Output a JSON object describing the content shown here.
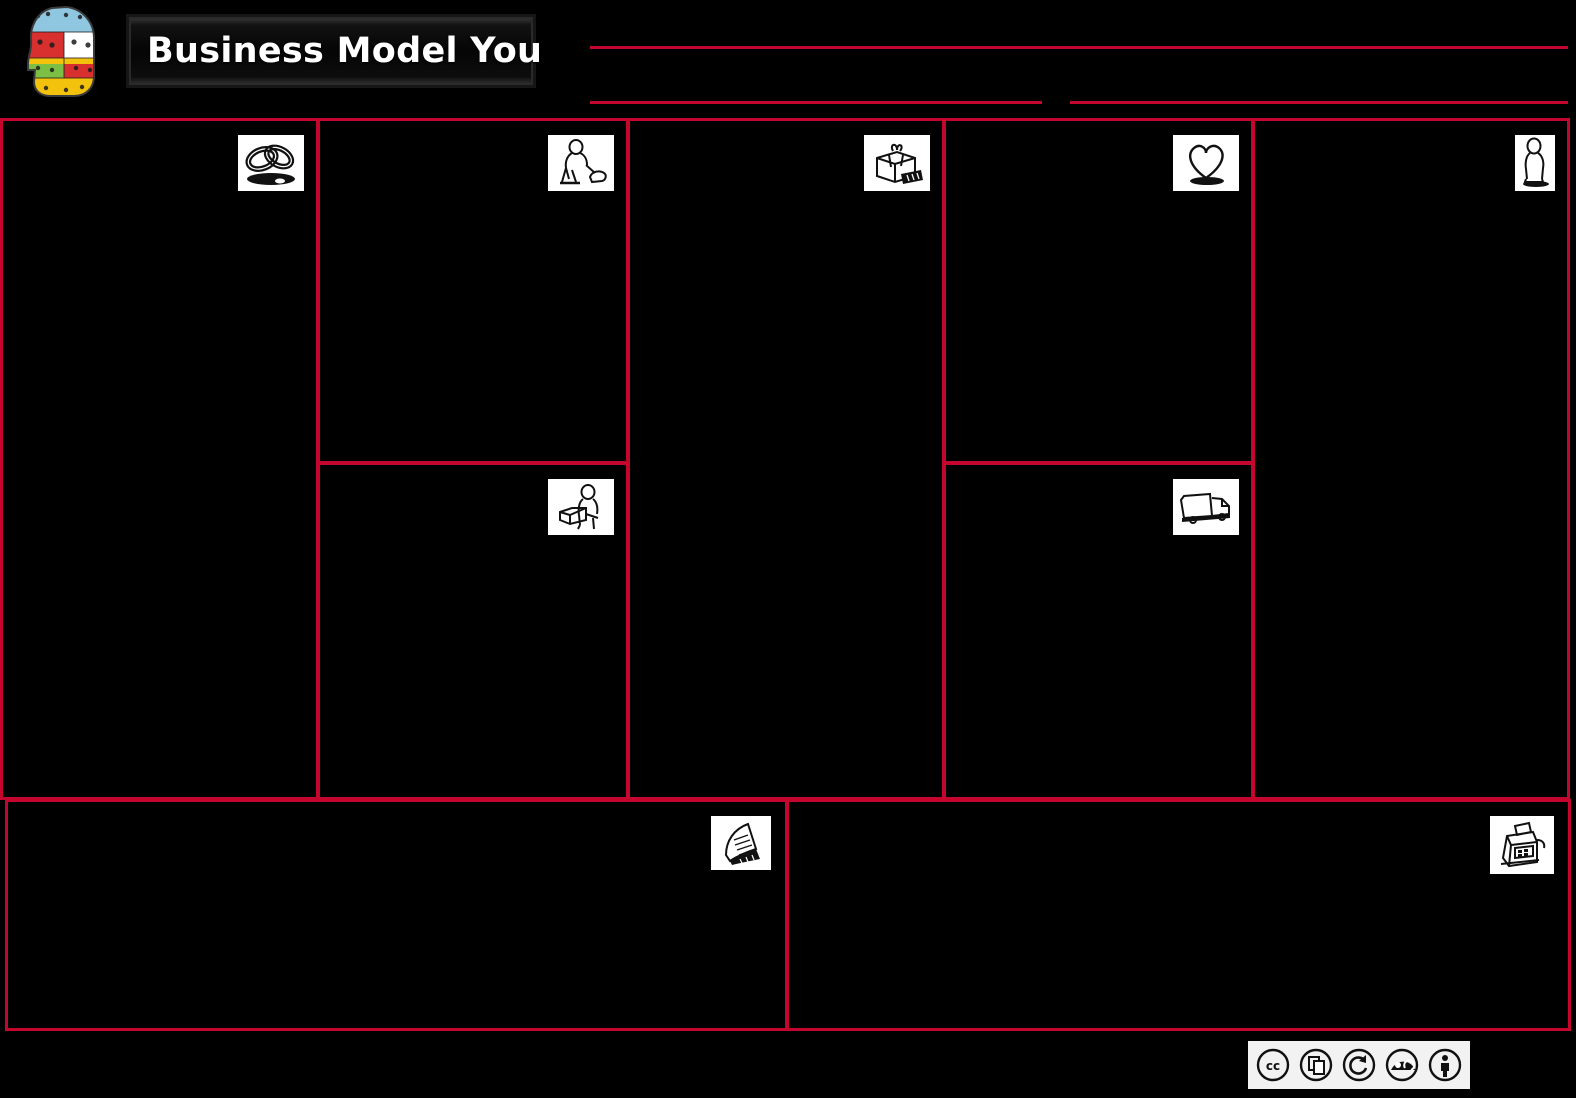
{
  "header": {
    "title": "Business Model You",
    "logo_icon": "head-canvas-logo",
    "fill_lines": [
      {
        "name": "headline-top",
        "value": ""
      },
      {
        "name": "headline-bottom-left",
        "value": ""
      },
      {
        "name": "headline-bottom-right",
        "value": ""
      }
    ]
  },
  "theme": {
    "accent": "#c4062e",
    "background": "#000000",
    "plate_text": "#ffffff",
    "icon_tile": "#ffffff"
  },
  "canvas": {
    "cells": [
      {
        "key": "key-partners",
        "label": "",
        "icon": "interlocking-rings-icon",
        "value": ""
      },
      {
        "key": "key-activities",
        "label": "",
        "icon": "person-working-icon",
        "value": ""
      },
      {
        "key": "key-resources",
        "label": "",
        "icon": "person-machine-icon",
        "value": ""
      },
      {
        "key": "value-provided",
        "label": "",
        "icon": "gift-box-icon",
        "value": ""
      },
      {
        "key": "customer-relationships",
        "label": "",
        "icon": "heart-icon",
        "value": ""
      },
      {
        "key": "channels",
        "label": "",
        "icon": "delivery-truck-icon",
        "value": ""
      },
      {
        "key": "customers",
        "label": "",
        "icon": "standing-person-icon",
        "value": ""
      }
    ]
  },
  "bottom": {
    "cells": [
      {
        "key": "costs",
        "label": "",
        "icon": "invoice-receipt-icon",
        "value": ""
      },
      {
        "key": "revenue",
        "label": "",
        "icon": "cash-register-icon",
        "value": ""
      }
    ]
  },
  "license": {
    "badges": [
      {
        "name": "cc-icon",
        "glyph": "cc"
      },
      {
        "name": "cc-share-icon",
        "glyph": "share"
      },
      {
        "name": "cc-sharealike-icon",
        "glyph": "sharealike"
      },
      {
        "name": "cc-noncommercial-icon",
        "glyph": "nc"
      },
      {
        "name": "cc-by-icon",
        "glyph": "by"
      }
    ]
  }
}
